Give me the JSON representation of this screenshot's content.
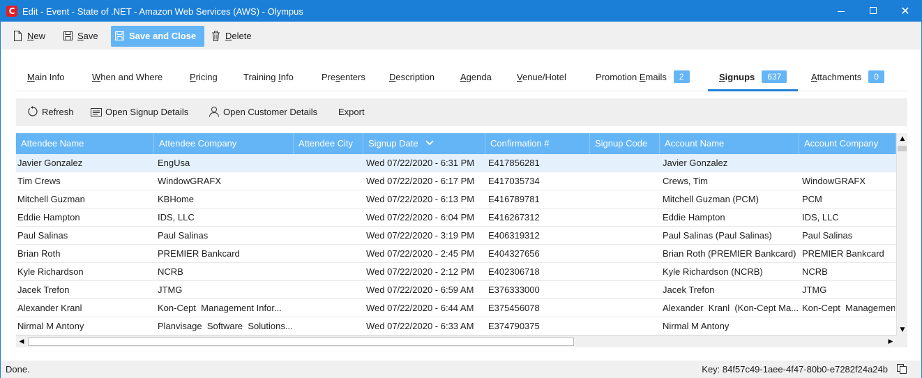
{
  "window": {
    "app_icon_letter": "C",
    "title": "Edit - Event - State of .NET - Amazon Web Services (AWS) - Olympus"
  },
  "toolbar": {
    "new": {
      "lead": "N",
      "rest": "ew"
    },
    "save": {
      "lead": "S",
      "rest": "ave"
    },
    "save_close": "Save and Close",
    "delete": {
      "lead": "D",
      "rest": "elete"
    }
  },
  "tabs": [
    {
      "label": "Main Info",
      "underline_index": 0
    },
    {
      "label": "When and Where",
      "underline_index": 0
    },
    {
      "label": "Pricing",
      "underline_index": 0
    },
    {
      "label": "Training Info",
      "underline_index": 9
    },
    {
      "label": "Presenters",
      "underline_index": 3
    },
    {
      "label": "Description",
      "underline_index": 0
    },
    {
      "label": "Agenda",
      "underline_index": 0
    },
    {
      "label": "Venue/Hotel",
      "underline_index": 0
    },
    {
      "label": "Promotion Emails",
      "underline_index": 10,
      "badge": "2"
    },
    {
      "label": "Signups",
      "underline_index": 0,
      "badge": "637",
      "active": true
    },
    {
      "label": "Attachments",
      "underline_index": 0,
      "badge": "0"
    }
  ],
  "subtoolbar": {
    "refresh": "Refresh",
    "open_signup": "Open Signup Details",
    "open_customer": "Open Customer Details",
    "export": "Export"
  },
  "grid": {
    "columns": [
      "Attendee Name",
      "Attendee Company",
      "Attendee City",
      "Signup Date",
      "Confirmation #",
      "Signup Code",
      "Account Name",
      "Account Company"
    ],
    "sorted_column": "Signup Date",
    "sort_direction": "descending",
    "selected_row": 0,
    "rows": [
      [
        "Javier Gonzalez",
        "EngUsa",
        "",
        "Wed 07/22/2020 - 6:31 PM",
        "E417856281",
        "",
        "Javier Gonzalez",
        ""
      ],
      [
        "Tim Crews",
        "WindowGRAFX",
        "",
        "Wed 07/22/2020 - 6:17 PM",
        "E417035734",
        "",
        "Crews, Tim",
        "WindowGRAFX"
      ],
      [
        "Mitchell Guzman",
        "KBHome",
        "",
        "Wed 07/22/2020 - 6:13 PM",
        "E416789781",
        "",
        "Mitchell Guzman (PCM)",
        "PCM"
      ],
      [
        "Eddie Hampton",
        "IDS, LLC",
        "",
        "Wed 07/22/2020 - 6:04 PM",
        "E416267312",
        "",
        "Eddie Hampton",
        "IDS, LLC"
      ],
      [
        "Paul Salinas",
        "Paul Salinas",
        "",
        "Wed 07/22/2020 - 3:19 PM",
        "E406319312",
        "",
        "Paul Salinas (Paul Salinas)",
        "Paul Salinas"
      ],
      [
        "Brian Roth",
        "PREMIER Bankcard",
        "",
        "Wed 07/22/2020 - 2:45 PM",
        "E404327656",
        "",
        "Brian Roth (PREMIER Bankcard)",
        "PREMIER Bankcard"
      ],
      [
        "Kyle Richardson",
        "NCRB",
        "",
        "Wed 07/22/2020 - 2:12 PM",
        "E402306718",
        "",
        "Kyle Richardson (NCRB)",
        "NCRB"
      ],
      [
        "Jacek Trefon",
        "JTMG",
        "",
        "Wed 07/22/2020 - 6:59 AM",
        "E376333000",
        "",
        "Jacek Trefon",
        "JTMG"
      ],
      [
        "Alexander Kranl",
        "Kon-Cept  Management Infor...",
        "",
        "Wed 07/22/2020 - 6:44 AM",
        "E375456078",
        "",
        "Alexander  Kranl  (Kon-Cept Ma...",
        "Kon-Cept  Managemen"
      ],
      [
        "Nirmal M Antony",
        "Planvisage  Software  Solutions...",
        "",
        "Wed 07/22/2020 - 6:33 AM",
        "E374790375",
        "",
        "Nirmal M Antony",
        ""
      ]
    ]
  },
  "status": {
    "text": "Done.",
    "key": "Key: 84f57c49-1aee-4f47-80b0-e7282f24a24b"
  },
  "colors": {
    "titlebar": "#1c7fd7",
    "accent": "#64b5f6",
    "selected_row": "#e4f1fd",
    "app_icon": "#e21f26"
  }
}
